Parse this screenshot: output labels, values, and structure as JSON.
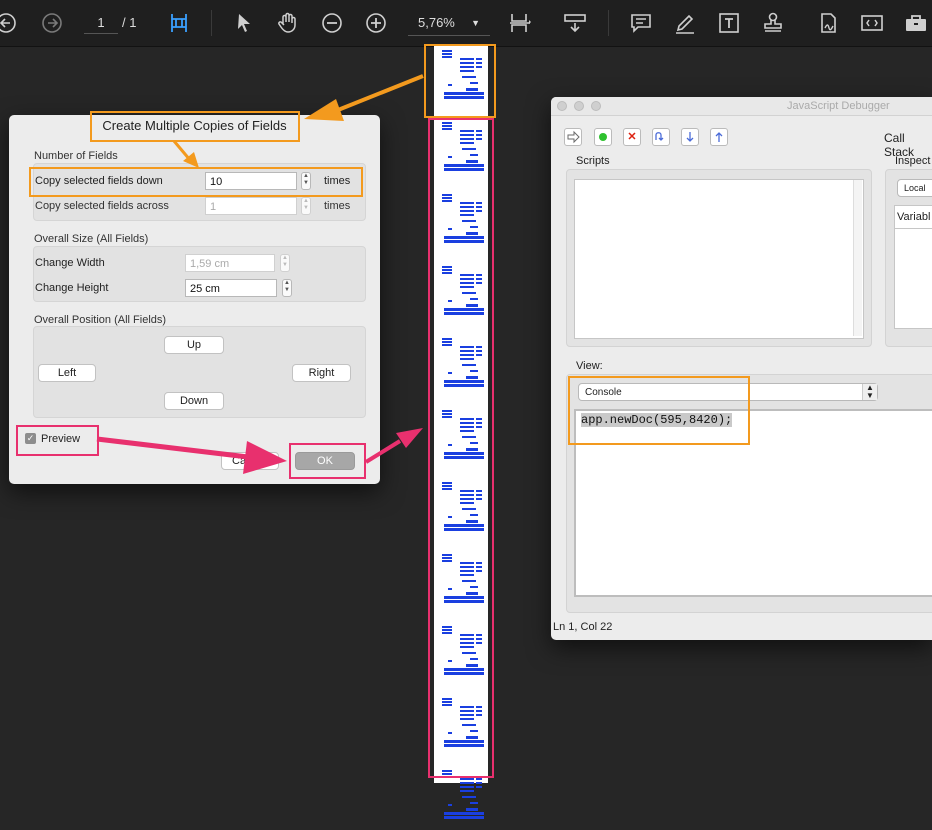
{
  "toolbar": {
    "page_current": "1",
    "page_total": "/ 1",
    "zoom": "5,76%",
    "icons": [
      "back-icon",
      "forward-icon",
      "fit-page-icon",
      "select-arrow-icon",
      "hand-icon",
      "zoom-out-icon",
      "zoom-in-icon",
      "page-display-icon",
      "scroll-icon",
      "comment-icon",
      "highlight-icon",
      "text-box-icon",
      "stamp-icon",
      "sign-icon",
      "form-field-icon",
      "toolbox-icon"
    ]
  },
  "dialog": {
    "title": "Create Multiple Copies of Fields",
    "number_group": "Number of Fields",
    "down_label": "Copy selected fields down",
    "down_value": "10",
    "across_label": "Copy selected fields across",
    "across_value": "1",
    "times_label": "times",
    "size_group": "Overall Size (All Fields)",
    "width_label": "Change Width",
    "width_value": "1,59 cm",
    "height_label": "Change Height",
    "height_value": "25 cm",
    "position_group": "Overall Position (All Fields)",
    "up": "Up",
    "left": "Left",
    "right": "Right",
    "down": "Down",
    "preview_label": "Preview",
    "cancel_partial": "Ca",
    "ok": "OK"
  },
  "debugger": {
    "title": "JavaScript Debugger",
    "call_stack": "Call Stack",
    "scripts": "Scripts",
    "inspect": "Inspect",
    "local": "Local",
    "variable": "Variabl",
    "view_label": "View:",
    "view_select": "Console",
    "console_code": "app.newDoc(595,8420);",
    "status": "Ln 1, Col 22"
  },
  "colors": {
    "orange_highlight": "#f39a1e",
    "pink_highlight": "#e8306e",
    "field_blue": "#1a3fe0"
  }
}
